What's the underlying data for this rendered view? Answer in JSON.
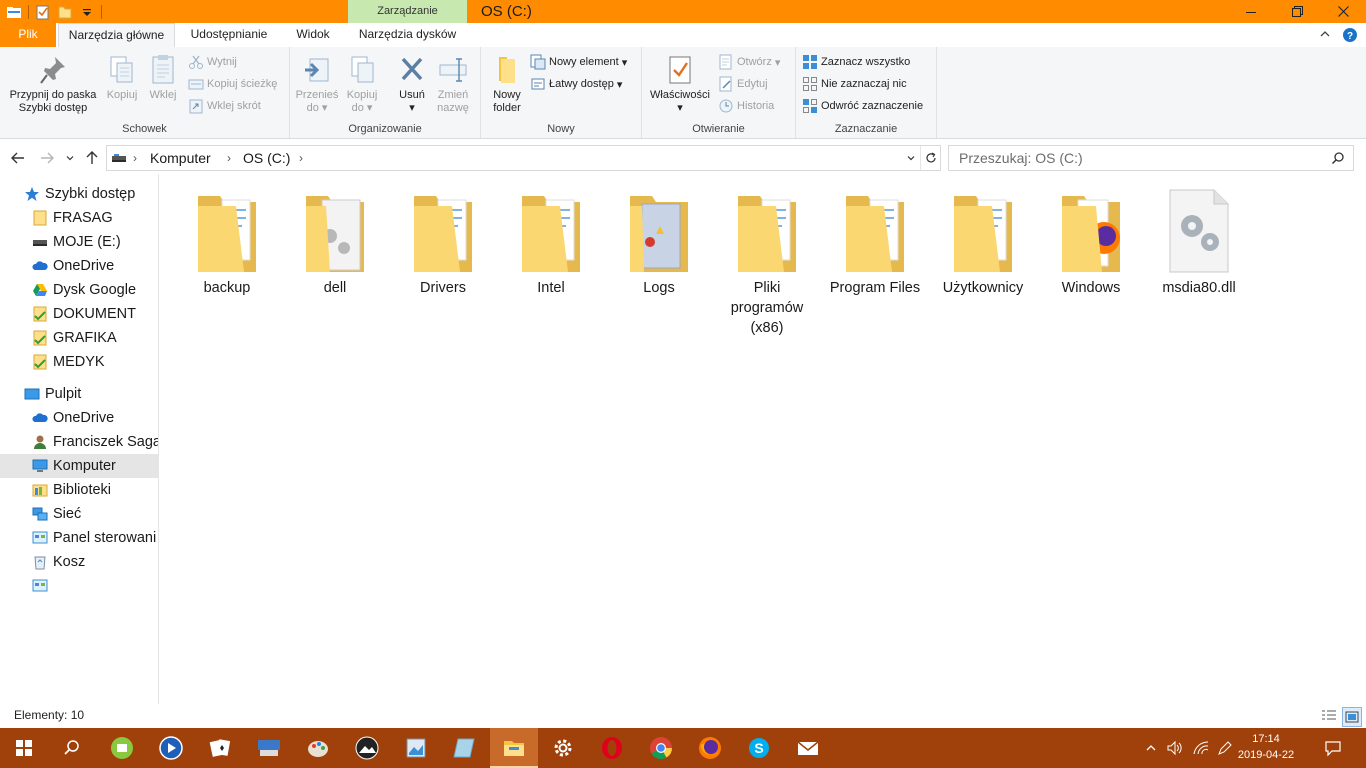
{
  "window": {
    "title": "OS (C:)",
    "context_tab": "Zarządzanie"
  },
  "ribbon_tabs": {
    "file": "Plik",
    "home": "Narzędzia główne",
    "share": "Udostępnianie",
    "view": "Widok",
    "drive_tools": "Narzędzia dysków"
  },
  "ribbon": {
    "clipboard": {
      "label": "Schowek",
      "pin": "Przypnij do paska Szybki dostęp",
      "pin_l1": "Przypnij do paska",
      "pin_l2": "Szybki dostęp",
      "copy": "Kopiuj",
      "paste": "Wklej",
      "cut": "Wytnij",
      "copy_path": "Kopiuj ścieżkę",
      "paste_shortcut": "Wklej skrót"
    },
    "organize": {
      "label": "Organizowanie",
      "move_l1": "Przenieś",
      "move_l2": "do",
      "copyto_l1": "Kopiuj",
      "copyto_l2": "do",
      "delete": "Usuń",
      "rename_l1": "Zmień",
      "rename_l2": "nazwę"
    },
    "new": {
      "label": "Nowy",
      "folder_l1": "Nowy",
      "folder_l2": "folder",
      "new_item": "Nowy element",
      "easy_access": "Łatwy dostęp"
    },
    "open": {
      "label": "Otwieranie",
      "properties": "Właściwości",
      "open": "Otwórz",
      "edit": "Edytuj",
      "history": "Historia"
    },
    "select": {
      "label": "Zaznaczanie",
      "select_all": "Zaznacz wszystko",
      "select_none": "Nie zaznaczaj nic",
      "invert": "Odwróć zaznaczenie"
    }
  },
  "address": {
    "crumbs": [
      "Komputer",
      "OS (C:)"
    ],
    "search_placeholder": "Przeszukaj: OS (C:)"
  },
  "nav_pane": {
    "quick_access": "Szybki dostęp",
    "quick_items": [
      "FRASAG",
      "MOJE (E:)",
      "OneDrive",
      "Dysk Google",
      "DOKUMENT",
      "GRAFIKA",
      "MEDYK"
    ],
    "desktop": "Pulpit",
    "desktop_items": [
      "OneDrive",
      "Franciszek Saga",
      "Komputer",
      "Biblioteki",
      "Sieć",
      "Panel sterowani",
      "Kosz"
    ]
  },
  "content": {
    "items": [
      {
        "name": "backup",
        "type": "folder"
      },
      {
        "name": "dell",
        "type": "folder-gear"
      },
      {
        "name": "Drivers",
        "type": "folder"
      },
      {
        "name": "Intel",
        "type": "folder"
      },
      {
        "name": "Logs",
        "type": "folder-logs"
      },
      {
        "name": "Pliki programów (x86)",
        "l1": "Pliki",
        "l2": "programów",
        "l3": "(x86)",
        "type": "folder"
      },
      {
        "name": "Program Files",
        "type": "folder"
      },
      {
        "name": "Użytkownicy",
        "type": "folder"
      },
      {
        "name": "Windows",
        "type": "folder-firefox"
      },
      {
        "name": "msdia80.dll",
        "type": "dll"
      }
    ]
  },
  "status": {
    "items_count": "Elementy: 10"
  },
  "taskbar": {
    "time": "17:14",
    "date": "2019-04-22"
  },
  "colors": {
    "accent": "#ff8c00",
    "taskbar": "#a0400a",
    "context_tab": "#c7e9b0",
    "folder": "#f8d775",
    "selected": "#e5e5e5"
  }
}
